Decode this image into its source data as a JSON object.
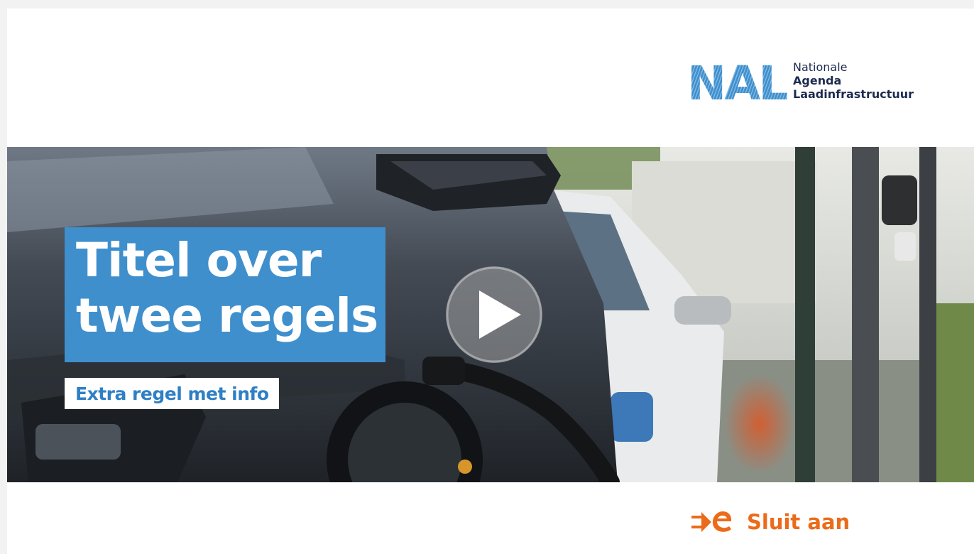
{
  "logo": {
    "mark_text": "NAL",
    "line1": "Nationale",
    "line2": "Agenda",
    "line3": "Laadinfrastructuur",
    "color": "#3f8fcd"
  },
  "hero": {
    "title_line1": "Titel over",
    "title_line2": "twee regels",
    "subtitle": "Extra regel met info",
    "title_bg": "#3f8fcd",
    "image_subject": "electric car charging at street charger",
    "play_icon": "play-icon"
  },
  "footer": {
    "brand_label": "Sluit aan",
    "brand_icon": "plug-e-icon",
    "brand_color": "#ec6b1a"
  }
}
